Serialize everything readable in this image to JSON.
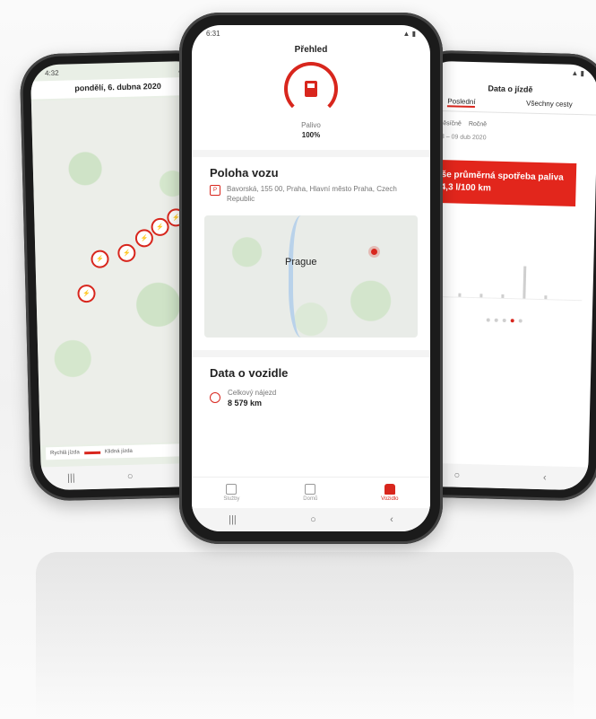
{
  "left_phone": {
    "status_time": "4:32",
    "title": "pondělí, 6. dubna 2020",
    "legend": {
      "fast_label": "Rychlá jízda",
      "calm_label": "Klidná jízda"
    },
    "nav": [
      "|||",
      "○",
      "‹"
    ]
  },
  "center_phone": {
    "status_time": "6:31",
    "header": "Přehled",
    "fuel": {
      "label": "Palivo",
      "value": "100%"
    },
    "location": {
      "title": "Poloha vozu",
      "address": "Bavorská, 155 00, Praha, Hlavní město Praha, Czech Republic",
      "map_label": "Prague"
    },
    "vehicle": {
      "title": "Data o vozidle",
      "odometer_label": "Celkový nájezd",
      "odometer_value": "8 579 km"
    },
    "bottom_tabs": [
      "Služby",
      "Domů",
      "Vozidlo"
    ],
    "nav": [
      "|||",
      "○",
      "‹"
    ]
  },
  "right_phone": {
    "title": "Data o jízdě",
    "tabs": [
      "Poslední",
      "Všechny cesty"
    ],
    "chips": [
      "Měsíčně",
      "Ročně"
    ],
    "range": "03 – 09 dub 2020",
    "banner": "Vaše průměrná spotřeba paliva je 4,3 l/100 km",
    "nav": [
      "○",
      "‹"
    ]
  },
  "colors": {
    "accent": "#d8261d"
  }
}
